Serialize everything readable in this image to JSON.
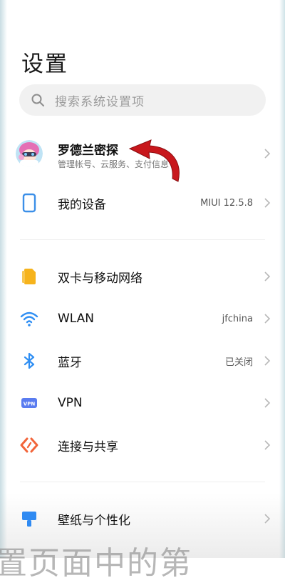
{
  "header": {
    "title": "设置"
  },
  "search": {
    "placeholder": "搜索系统设置项",
    "icon": "search-icon"
  },
  "profile": {
    "name": "罗德兰密探",
    "subtitle": "管理帐号、云服务、支付信息",
    "icon": "avatar"
  },
  "device": {
    "label": "我的设备",
    "value": "MIUI 12.5.8",
    "icon": "phone-icon",
    "color": "#3b8fe8"
  },
  "network": [
    {
      "label": "双卡与移动网络",
      "value": "",
      "icon": "sim-card-icon",
      "color": "#f6b31c"
    },
    {
      "label": "WLAN",
      "value": "jfchina",
      "icon": "wifi-icon",
      "color": "#2e8ef3"
    },
    {
      "label": "蓝牙",
      "value": "已关闭",
      "icon": "bluetooth-icon",
      "color": "#2e8ef3"
    },
    {
      "label": "VPN",
      "value": "",
      "icon": "vpn-icon",
      "color": "#5a7cf0"
    },
    {
      "label": "连接与共享",
      "value": "",
      "icon": "connection-share-icon",
      "color": "#f2653a"
    }
  ],
  "personal": [
    {
      "label": "壁纸与个性化",
      "value": "",
      "icon": "wallpaper-icon",
      "color": "#2f8af2"
    }
  ],
  "overlay": {
    "caption": "置页面中的第"
  }
}
